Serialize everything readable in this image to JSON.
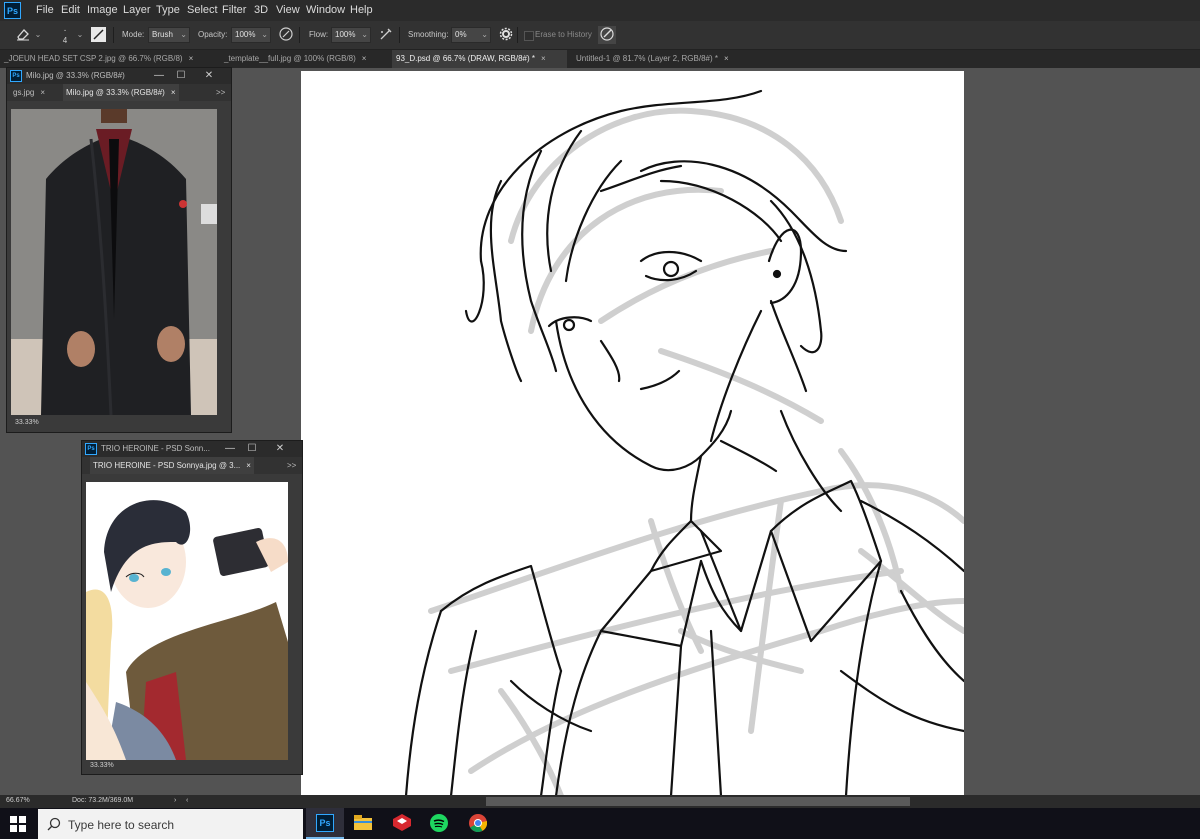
{
  "app": {
    "logo": "Ps",
    "accent": "#31a8ff"
  },
  "menu": [
    "File",
    "Edit",
    "Image",
    "Layer",
    "Type",
    "Select",
    "Filter",
    "3D",
    "View",
    "Window",
    "Help"
  ],
  "options": {
    "brush_size": "4",
    "mode_label": "Mode:",
    "mode_value": "Brush",
    "opacity_label": "Opacity:",
    "opacity_value": "100%",
    "flow_label": "Flow:",
    "flow_value": "100%",
    "smoothing_label": "Smoothing:",
    "smoothing_value": "0%",
    "erase_history_label": "Erase to History"
  },
  "tabs": [
    {
      "label": "_JOEUN HEAD SET CSP 2.jpg @ 66.7% (RGB/8)",
      "active": false
    },
    {
      "label": "_template__full.jpg @ 100% (RGB/8)",
      "active": false
    },
    {
      "label": "93_D.psd @ 66.7% (DRAW, RGB/8#) *",
      "active": true
    },
    {
      "label": "Untitled-1 @ 81.7% (Layer 2, RGB/8#) *",
      "active": false
    }
  ],
  "close_glyph": "×",
  "win1": {
    "title": "Milo.jpg @ 33.3% (RGB/8#)",
    "tab_prev": "gs.jpg",
    "tab_active": "Milo.jpg @ 33.3% (RGB/8#)",
    "zoom": "33.33%"
  },
  "win2": {
    "title": "TRIO HEROINE - PSD Sonn...",
    "tab_active": "TRIO HEROINE - PSD Sonnya.jpg @ 3...",
    "zoom": "33.33%"
  },
  "win_controls": {
    "minimize": "—",
    "restore": "☐",
    "close": "✕",
    "more": ">>"
  },
  "status": {
    "zoom": "66.67%",
    "doc": "Doc: 73.2M/369.0M",
    "nav_prev": "‹",
    "nav_next": "›"
  },
  "taskbar": {
    "search_placeholder": "Type here to search",
    "ps_label": "Ps"
  }
}
